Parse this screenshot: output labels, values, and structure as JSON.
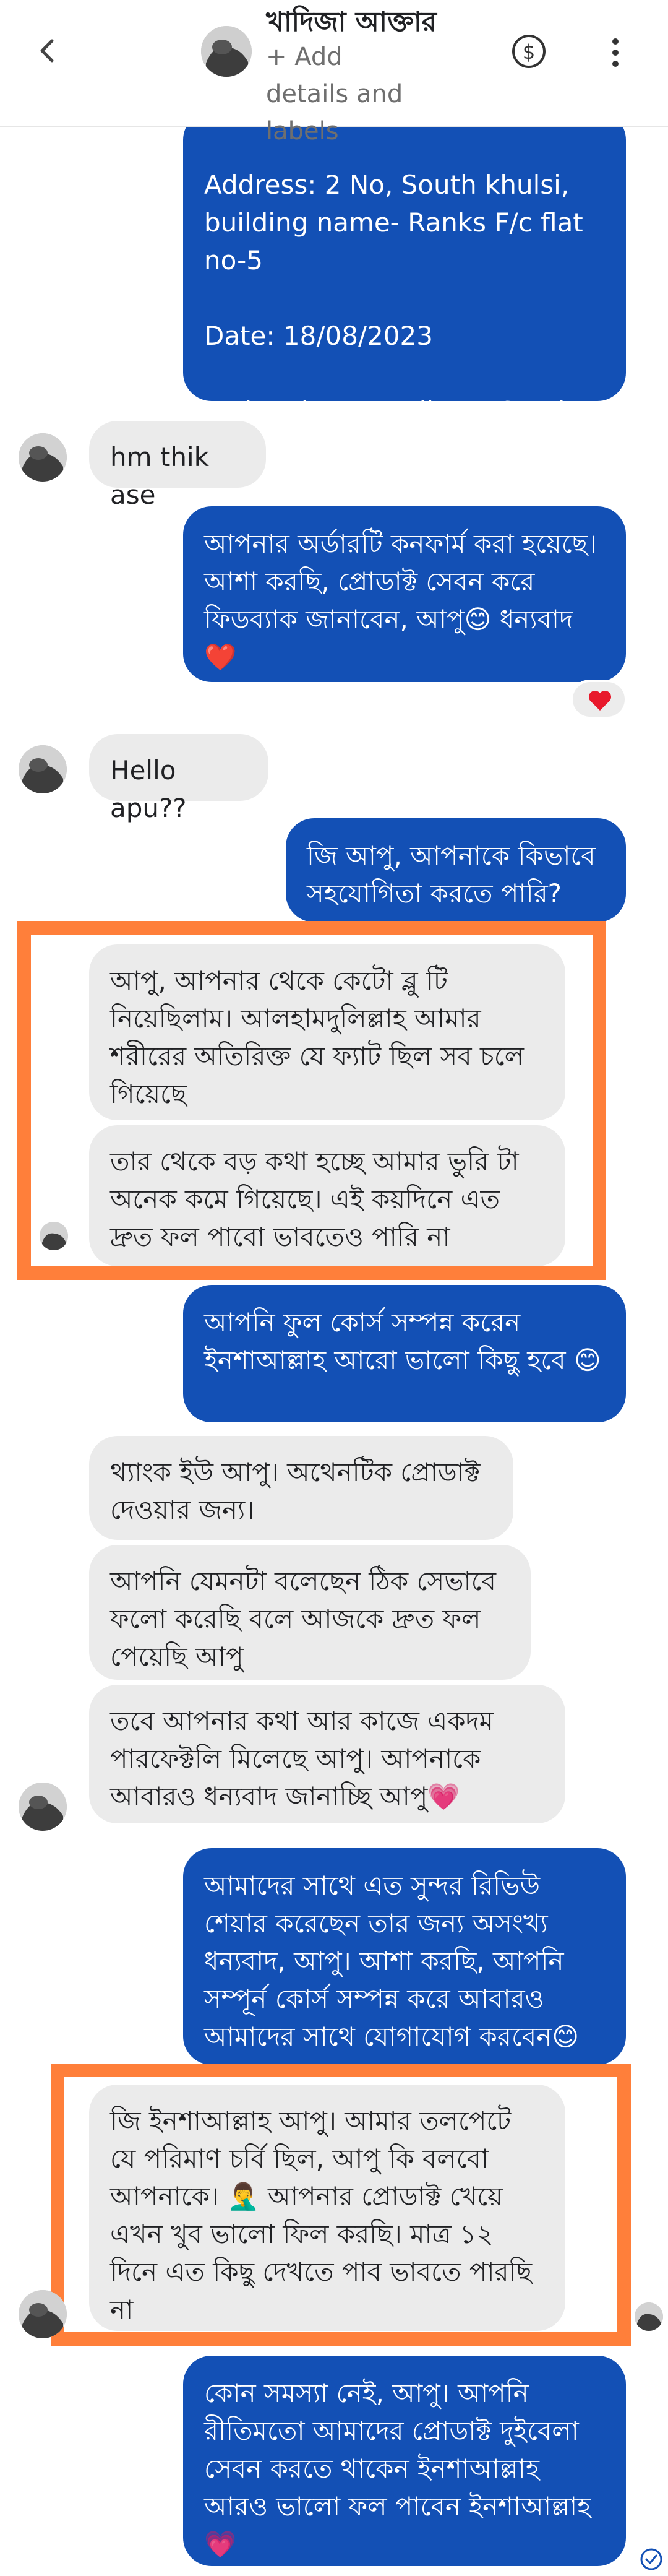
{
  "header": {
    "name": "খাদিজা আক্তার",
    "add_details": "+ Add details and labels"
  },
  "messages": {
    "m0": "Address: 2 No, South khulsi, building name- Ranks F/c flat no-5\n\nDate: 18/08/2023\n\nPathao home Delivery Service ✅",
    "m1": "hm thik ase",
    "m2": "আপনার অর্ডারটি কনফার্ম করা হয়েছে।  আশা করছি,  প্রোডাক্ট সেবন করে ফিডব্যাক জানাবেন, আপু😊 ধন্যবাদ❤️",
    "m3": "Hello apu??",
    "m4": "জি আপু, আপনাকে কিভাবে সহযোগিতা করতে পারি?",
    "m5": "আপু, আপনার থেকে কেটো ব্লু টি নিয়েছিলাম। আলহামদুলিল্লাহ আমার শরীরের অতিরিক্ত যে ফ্যাট ছিল সব চলে গিয়েছে",
    "m6": "তার থেকে বড় কথা হচ্ছে আমার ভুরি টা অনেক কমে গিয়েছে। এই কয়দিনে এত দ্রুত ফল পাবো ভাবতেও পারি না",
    "m7": "আপনি ফুল কোর্স সম্পন্ন করেন ইনশাআল্লাহ আরো ভালো কিছু হবে 😊",
    "m8": "থ্যাংক ইউ আপু। অথেনটিক প্রোডাক্ট দেওয়ার জন্য।",
    "m9": "আপনি যেমনটা বলেছেন ঠিক সেভাবে ফলো করেছি বলে আজকে দ্রুত ফল পেয়েছি আপু",
    "m10": "তবে আপনার কথা আর কাজে একদম পারফেক্টলি মিলেছে আপু। আপনাকে আবারও ধন্যবাদ জানাচ্ছি আপু💗",
    "m11": "আমাদের সাথে এত সুন্দর রিভিউ শেয়ার করেছেন তার জন্য অসংখ্য ধন্যবাদ, আপু। আশা করছি,  আপনি সম্পূর্ন কোর্স সম্পন্ন করে আবারও আমাদের সাথে যোগাযোগ করবেন😊",
    "m12": "জি ইনশাআল্লাহ আপু।  আমার তলপেটে যে পরিমাণ চর্বি ছিল, আপু কি বলবো আপনাকে। 🤦‍♂️ আপনার প্রোডাক্ট খেয়ে এখন খুব ভালো ফিল করছি। মাত্র ১২ দিনে এত কিছু দেখতে পাব ভাবতে পারছি না",
    "m13": "কোন সমস্যা নেই, আপু। আপনি রীতিমতো আমাদের প্রোডাক্ট দুইবেলা সেবন করতে থাকেন ইনশাআল্লাহ আরও ভালো ফল পাবেন ইনশাআল্লাহ 💗"
  },
  "reaction": "heart",
  "colors": {
    "outgoing_bubble": "#1350b5",
    "incoming_bubble": "#ebebeb",
    "highlight_box": "#ff7f3a"
  },
  "icons": [
    "back-arrow-icon",
    "dollar-icon",
    "more-vert-icon",
    "heart-icon",
    "read-check-icon"
  ]
}
